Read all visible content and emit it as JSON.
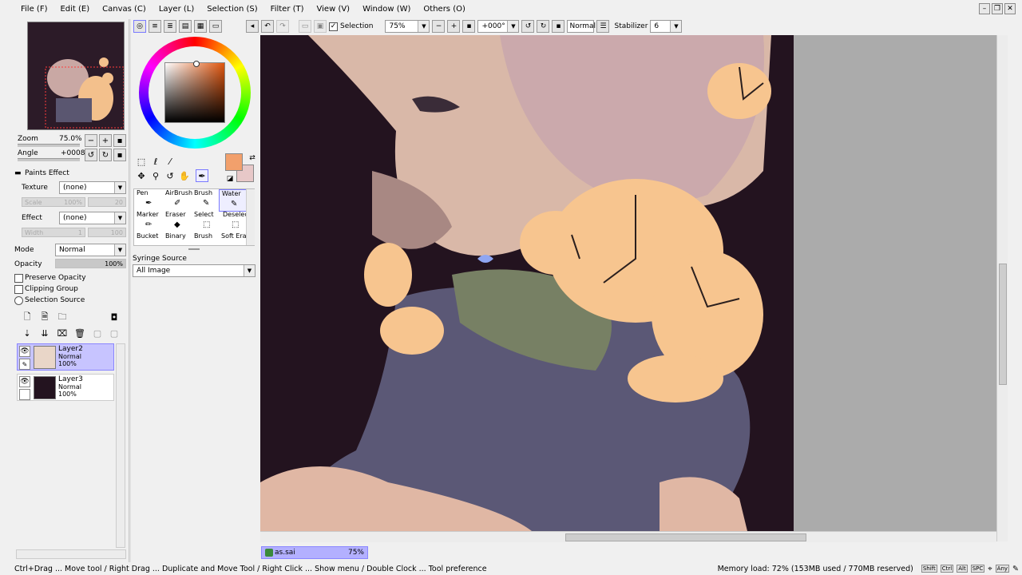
{
  "menu": [
    "File (F)",
    "Edit (E)",
    "Canvas (C)",
    "Layer (L)",
    "Selection (S)",
    "Filter (T)",
    "View (V)",
    "Window (W)",
    "Others (O)"
  ],
  "toolbar": {
    "selection_label": "Selection",
    "zoom_value": "75%",
    "rotation_value": "+000°",
    "blend_value": "Normal",
    "stabilizer_label": "Stabilizer",
    "stabilizer_value": "6"
  },
  "navigator": {
    "zoom_label": "Zoom",
    "zoom_value": "75.0%",
    "angle_label": "Angle",
    "angle_value": "+0008"
  },
  "paints_effect": {
    "title": "Paints Effect",
    "texture_label": "Texture",
    "texture_value": "(none)",
    "scale_label": "Scale",
    "scale_value": "100%",
    "scale_num": "20",
    "effect_label": "Effect",
    "effect_value": "(none)",
    "width_label": "Width",
    "width_value": "1",
    "width_num": "100"
  },
  "layer_props": {
    "mode_label": "Mode",
    "mode_value": "Normal",
    "opacity_label": "Opacity",
    "opacity_value": "100%",
    "preserve_opacity": "Preserve Opacity",
    "clipping_group": "Clipping Group",
    "selection_source": "Selection Source"
  },
  "layers": [
    {
      "name": "Layer2",
      "mode": "Normal",
      "opacity": "100%",
      "selected": true
    },
    {
      "name": "Layer3",
      "mode": "Normal",
      "opacity": "100%",
      "selected": false
    }
  ],
  "tools": [
    {
      "label": "Pen",
      "icon": "pen-icon"
    },
    {
      "label": "AirBrush",
      "icon": "airbrush-icon"
    },
    {
      "label": "Brush",
      "icon": "brush-icon"
    },
    {
      "label": "Water",
      "icon": "water-icon"
    },
    {
      "label": "Marker",
      "icon": "marker-icon"
    },
    {
      "label": "Eraser",
      "icon": "eraser-icon"
    },
    {
      "label": "Select",
      "icon": "select-icon"
    },
    {
      "label": "Deselect",
      "icon": "deselect-icon"
    },
    {
      "label": "Bucket",
      "icon": "bucket-icon"
    },
    {
      "label": "Binary",
      "icon": "binary-icon"
    },
    {
      "label": "Brush",
      "icon": "brush-icon"
    },
    {
      "label": "Soft Era",
      "icon": "soft-eraser-icon"
    }
  ],
  "syringe": {
    "label": "Syringe Source",
    "value": "All Image"
  },
  "colors": {
    "primary": "#f2a06c",
    "secondary": "#e7c8c8",
    "accent": "#8a86ff"
  },
  "document_tab": {
    "name": "as.sai",
    "zoom": "75%"
  },
  "status": {
    "hint": "Ctrl+Drag ... Move tool / Right Drag ... Duplicate and Move Tool / Right Click ... Show menu / Double Clock ... Tool preference",
    "memory": "Memory load: 72% (153MB used / 770MB reserved)",
    "keys": [
      "Shift",
      "Ctrl",
      "Alt",
      "SPC",
      "Any"
    ]
  }
}
